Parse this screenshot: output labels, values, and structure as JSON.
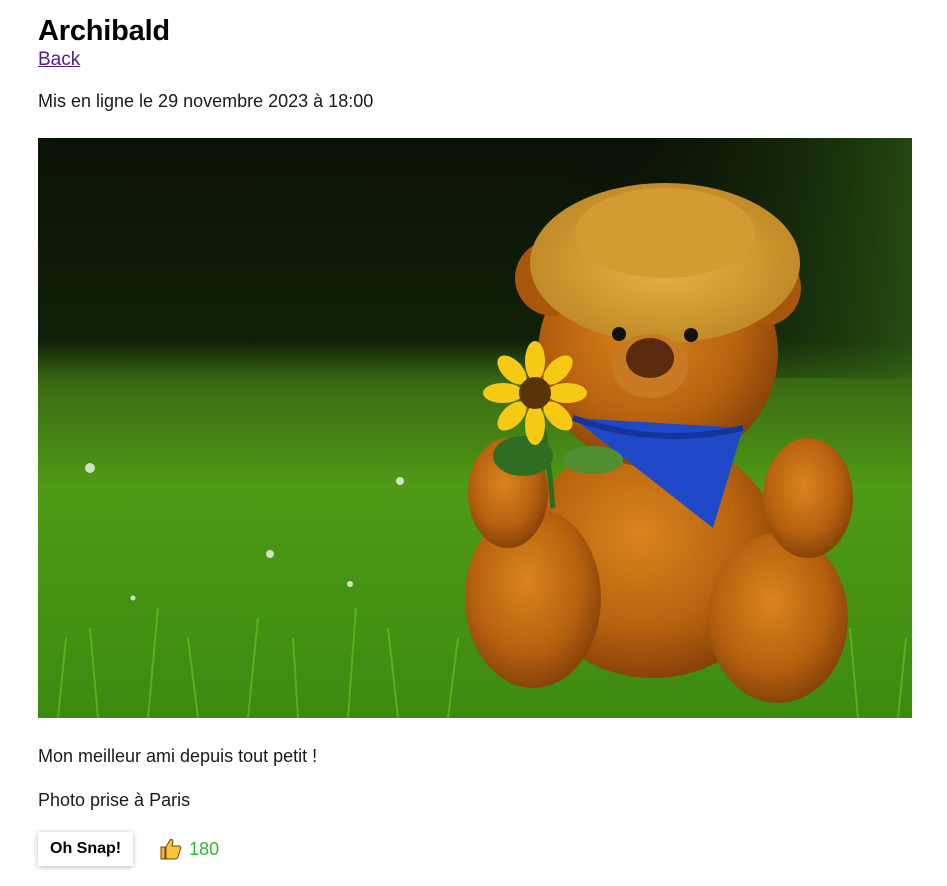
{
  "post": {
    "title": "Archibald",
    "back_label": "Back",
    "published": "Mis en ligne le 29 novembre 2023 à 18:00",
    "description": "Mon meilleur ami depuis tout petit !",
    "location": "Photo prise à Paris"
  },
  "actions": {
    "snap_label": "Oh Snap!",
    "like_icon": "thumbs-up-icon",
    "like_count": "180",
    "like_color": "#2eb82e"
  },
  "photo": {
    "subject": "teddy bear with straw hat, blue bandana and sunflower sitting in grass"
  }
}
